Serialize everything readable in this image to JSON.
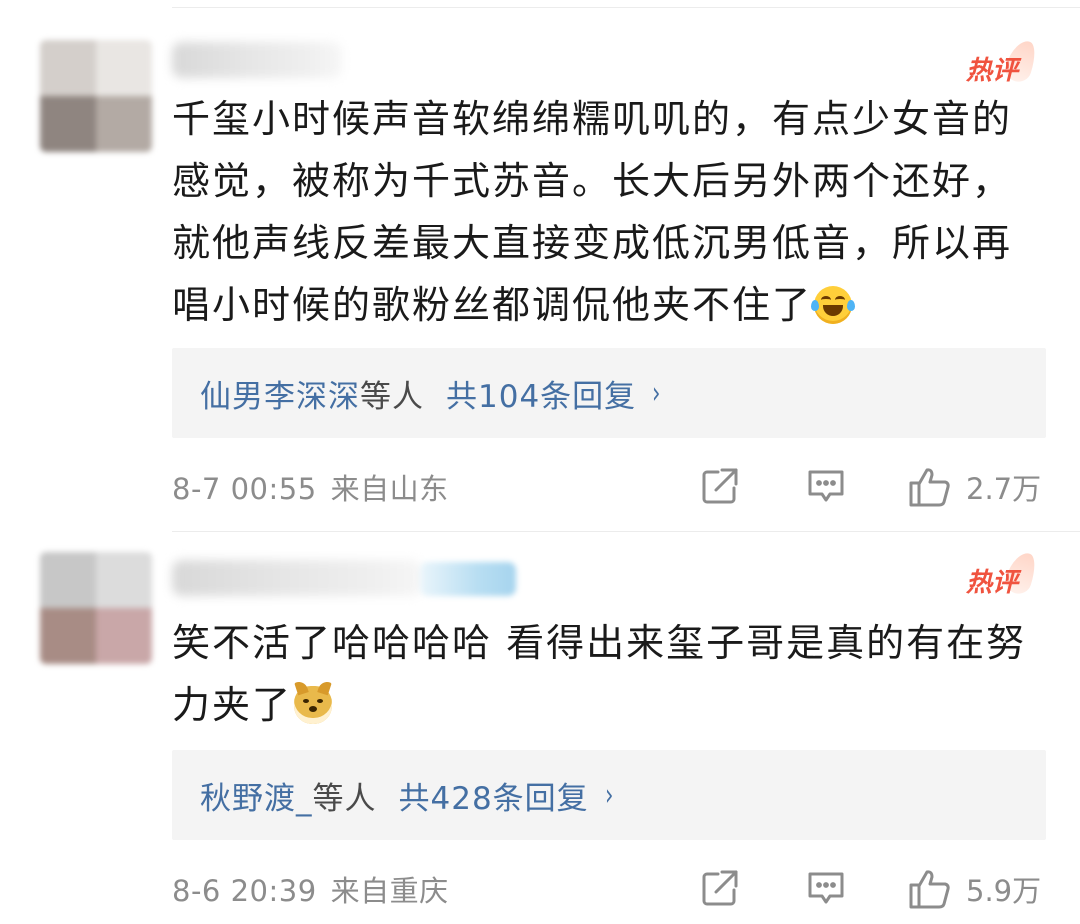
{
  "comments": [
    {
      "badge": "热评",
      "lines": [
        "千玺小时候声音软绵绵糯叽叽的，有点少女音的",
        "感觉，被称为千式苏音。长大后另外两个还好，",
        "就他声线反差最大直接变成低沉男低音，所以再",
        "唱小时候的歌粉丝都调侃他夹不住了"
      ],
      "emoji": "laughing-tears-emoji",
      "reply_user": "仙男李深深",
      "reply_etc": "等人",
      "reply_count": "共104条回复",
      "reply_arrow": "›",
      "time": "8-7 00:55",
      "location": "来自山东",
      "likes": "2.7万"
    },
    {
      "badge": "热评",
      "lines": [
        "笑不活了哈哈哈哈 看得出来玺子哥是真的有在努",
        "力夹了"
      ],
      "emoji": "doge-emoji",
      "reply_user": "秋野渡_",
      "reply_etc": "等人",
      "reply_count": "共428条回复",
      "reply_arrow": "›",
      "time": "8-6 20:39",
      "location": "来自重庆",
      "likes": "5.9万"
    }
  ],
  "colors": {
    "hot_badge": "#f0533f",
    "link_blue": "#446fa3",
    "meta_gray": "#8c8c8c",
    "reply_bg": "#f4f4f4"
  },
  "icons": [
    "share-icon",
    "comment-icon",
    "like-icon"
  ]
}
